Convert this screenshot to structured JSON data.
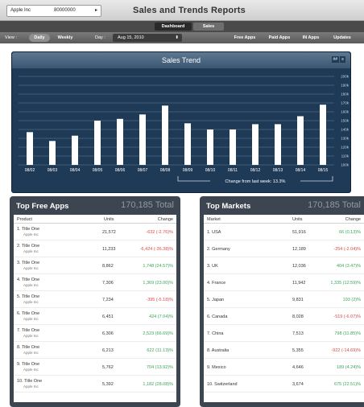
{
  "header": {
    "account_name": "Apple Inc",
    "account_number": "80000000",
    "title": "Sales and Trends Reports"
  },
  "tabs": [
    {
      "label": "Dashboard",
      "active": true
    },
    {
      "label": "Sales",
      "active": false
    }
  ],
  "filters": {
    "view_label": "View :",
    "daily_label": "Daily",
    "weekly_label": "Weekly",
    "day_label": "Day :",
    "date_value": "Aug 15, 2010",
    "app_types": [
      "Free Apps",
      "Paid Apps",
      "IN Apps",
      "Updates"
    ]
  },
  "trend": {
    "title": "Sales Trend",
    "icons": [
      "chart-icon",
      "table-icon"
    ],
    "icon_text": [
      "##",
      "≡"
    ],
    "change_label": "Change from last week: 13.3%"
  },
  "chart_data": {
    "type": "bar",
    "title": "Sales Trend",
    "categories": [
      "08/02",
      "08/03",
      "08/04",
      "08/05",
      "08/06",
      "08/07",
      "08/08",
      "08/09",
      "08/10",
      "08/11",
      "08/12",
      "08/13",
      "08/14",
      "08/15"
    ],
    "values": [
      137,
      127,
      133,
      150,
      152,
      157,
      167,
      147,
      140,
      140,
      146,
      146,
      155,
      168
    ],
    "ylim": [
      100,
      200
    ],
    "yticks": [
      "100k",
      "110k",
      "120k",
      "130k",
      "140k",
      "150k",
      "160k",
      "170k",
      "180k",
      "190k",
      "200k"
    ],
    "grid": true
  },
  "top_free": {
    "title": "Top Free Apps",
    "total": "170,185 Total",
    "columns": [
      "Product",
      "Units",
      "Change"
    ],
    "rows": [
      {
        "name": "1. Title One",
        "sub": "Apple Inc",
        "units": "21,572",
        "change": "-632 (-2.76)%",
        "trend": "neg"
      },
      {
        "name": "2. Title One",
        "sub": "Apple Inc",
        "units": "11,233",
        "change": "-6,424 (-36.38)%",
        "trend": "neg"
      },
      {
        "name": "3. Title One",
        "sub": "Apple Inc",
        "units": "8,862",
        "change": "1,748 (24.57)%",
        "trend": "pos"
      },
      {
        "name": "4. Title One",
        "sub": "Apple Inc",
        "units": "7,306",
        "change": "1,369 (23.00)%",
        "trend": "pos"
      },
      {
        "name": "5. Title One",
        "sub": "Apple Inc",
        "units": "7,234",
        "change": "-395 (-5.18)%",
        "trend": "neg"
      },
      {
        "name": "6. Title One",
        "sub": "Apple Inc",
        "units": "6,451",
        "change": "424 (7.04)%",
        "trend": "pos"
      },
      {
        "name": "7. Title One",
        "sub": "Apple Inc",
        "units": "6,306",
        "change": "2,523 (66.69)%",
        "trend": "pos"
      },
      {
        "name": "8. Title One",
        "sub": "Apple Inc",
        "units": "6,213",
        "change": "622 (11.13)%",
        "trend": "pos"
      },
      {
        "name": "9. Title One",
        "sub": "Apple Inc",
        "units": "5,762",
        "change": "704 (13.92)%",
        "trend": "pos"
      },
      {
        "name": "10. Title One",
        "sub": "Apple Inc",
        "units": "5,392",
        "change": "1,182 (28.08)%",
        "trend": "pos"
      }
    ]
  },
  "top_markets": {
    "title": "Top Markets",
    "total": "170,185 Total",
    "columns": [
      "Market",
      "Units",
      "Change"
    ],
    "rows": [
      {
        "name": "1. USA",
        "units": "51,916",
        "change": "66 (0.13)%",
        "trend": "pos"
      },
      {
        "name": "2. Germany",
        "units": "12,189",
        "change": "-254 (-2.04)%",
        "trend": "neg"
      },
      {
        "name": "3. UK",
        "units": "12,036",
        "change": "404 (3.47)%",
        "trend": "pos"
      },
      {
        "name": "4. France",
        "units": "11,942",
        "change": "1,335 (12.59)%",
        "trend": "pos"
      },
      {
        "name": "5. Japan",
        "units": "9,831",
        "change": "193 (2)%",
        "trend": "pos"
      },
      {
        "name": "6. Canada",
        "units": "8,028",
        "change": "-519 (-6.07)%",
        "trend": "neg"
      },
      {
        "name": "7. China",
        "units": "7,513",
        "change": "798 (11.85)%",
        "trend": "pos"
      },
      {
        "name": "8. Australia",
        "units": "5,355",
        "change": "-922 (-14.69)%",
        "trend": "neg"
      },
      {
        "name": "9. Mexico",
        "units": "4,646",
        "change": "189 (4.24)%",
        "trend": "pos"
      },
      {
        "name": "10. Switzerland",
        "units": "3,674",
        "change": "675 (22.51)%",
        "trend": "pos"
      }
    ]
  },
  "colors": {
    "chart_bg": "#1f3a56",
    "bar": "#ffffff",
    "grid": "#4e6882",
    "negative": "#d94a4a",
    "positive": "#3aa55a"
  }
}
